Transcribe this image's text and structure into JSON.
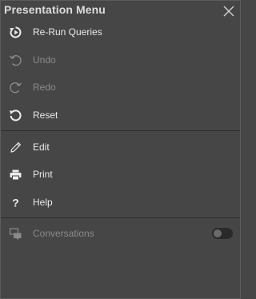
{
  "title": "Presentation Menu",
  "items_top": [
    {
      "label": "Re-Run Queries",
      "icon": "rerun-icon",
      "enabled": true
    },
    {
      "label": "Undo",
      "icon": "undo-icon",
      "enabled": false
    },
    {
      "label": "Redo",
      "icon": "redo-icon",
      "enabled": false
    },
    {
      "label": "Reset",
      "icon": "reset-icon",
      "enabled": true
    }
  ],
  "items_middle": [
    {
      "label": "Edit",
      "icon": "pencil-icon",
      "enabled": true
    },
    {
      "label": "Print",
      "icon": "printer-icon",
      "enabled": true
    },
    {
      "label": "Help",
      "icon": "help-icon",
      "enabled": true
    }
  ],
  "conversations": {
    "label": "Conversations",
    "icon": "conversations-icon",
    "enabled": false,
    "toggle_on": false
  },
  "colors": {
    "background": "#464646",
    "text": "#eaeaea",
    "disabled_text": "#8a8a8a",
    "divider": "#2e2e2e"
  }
}
